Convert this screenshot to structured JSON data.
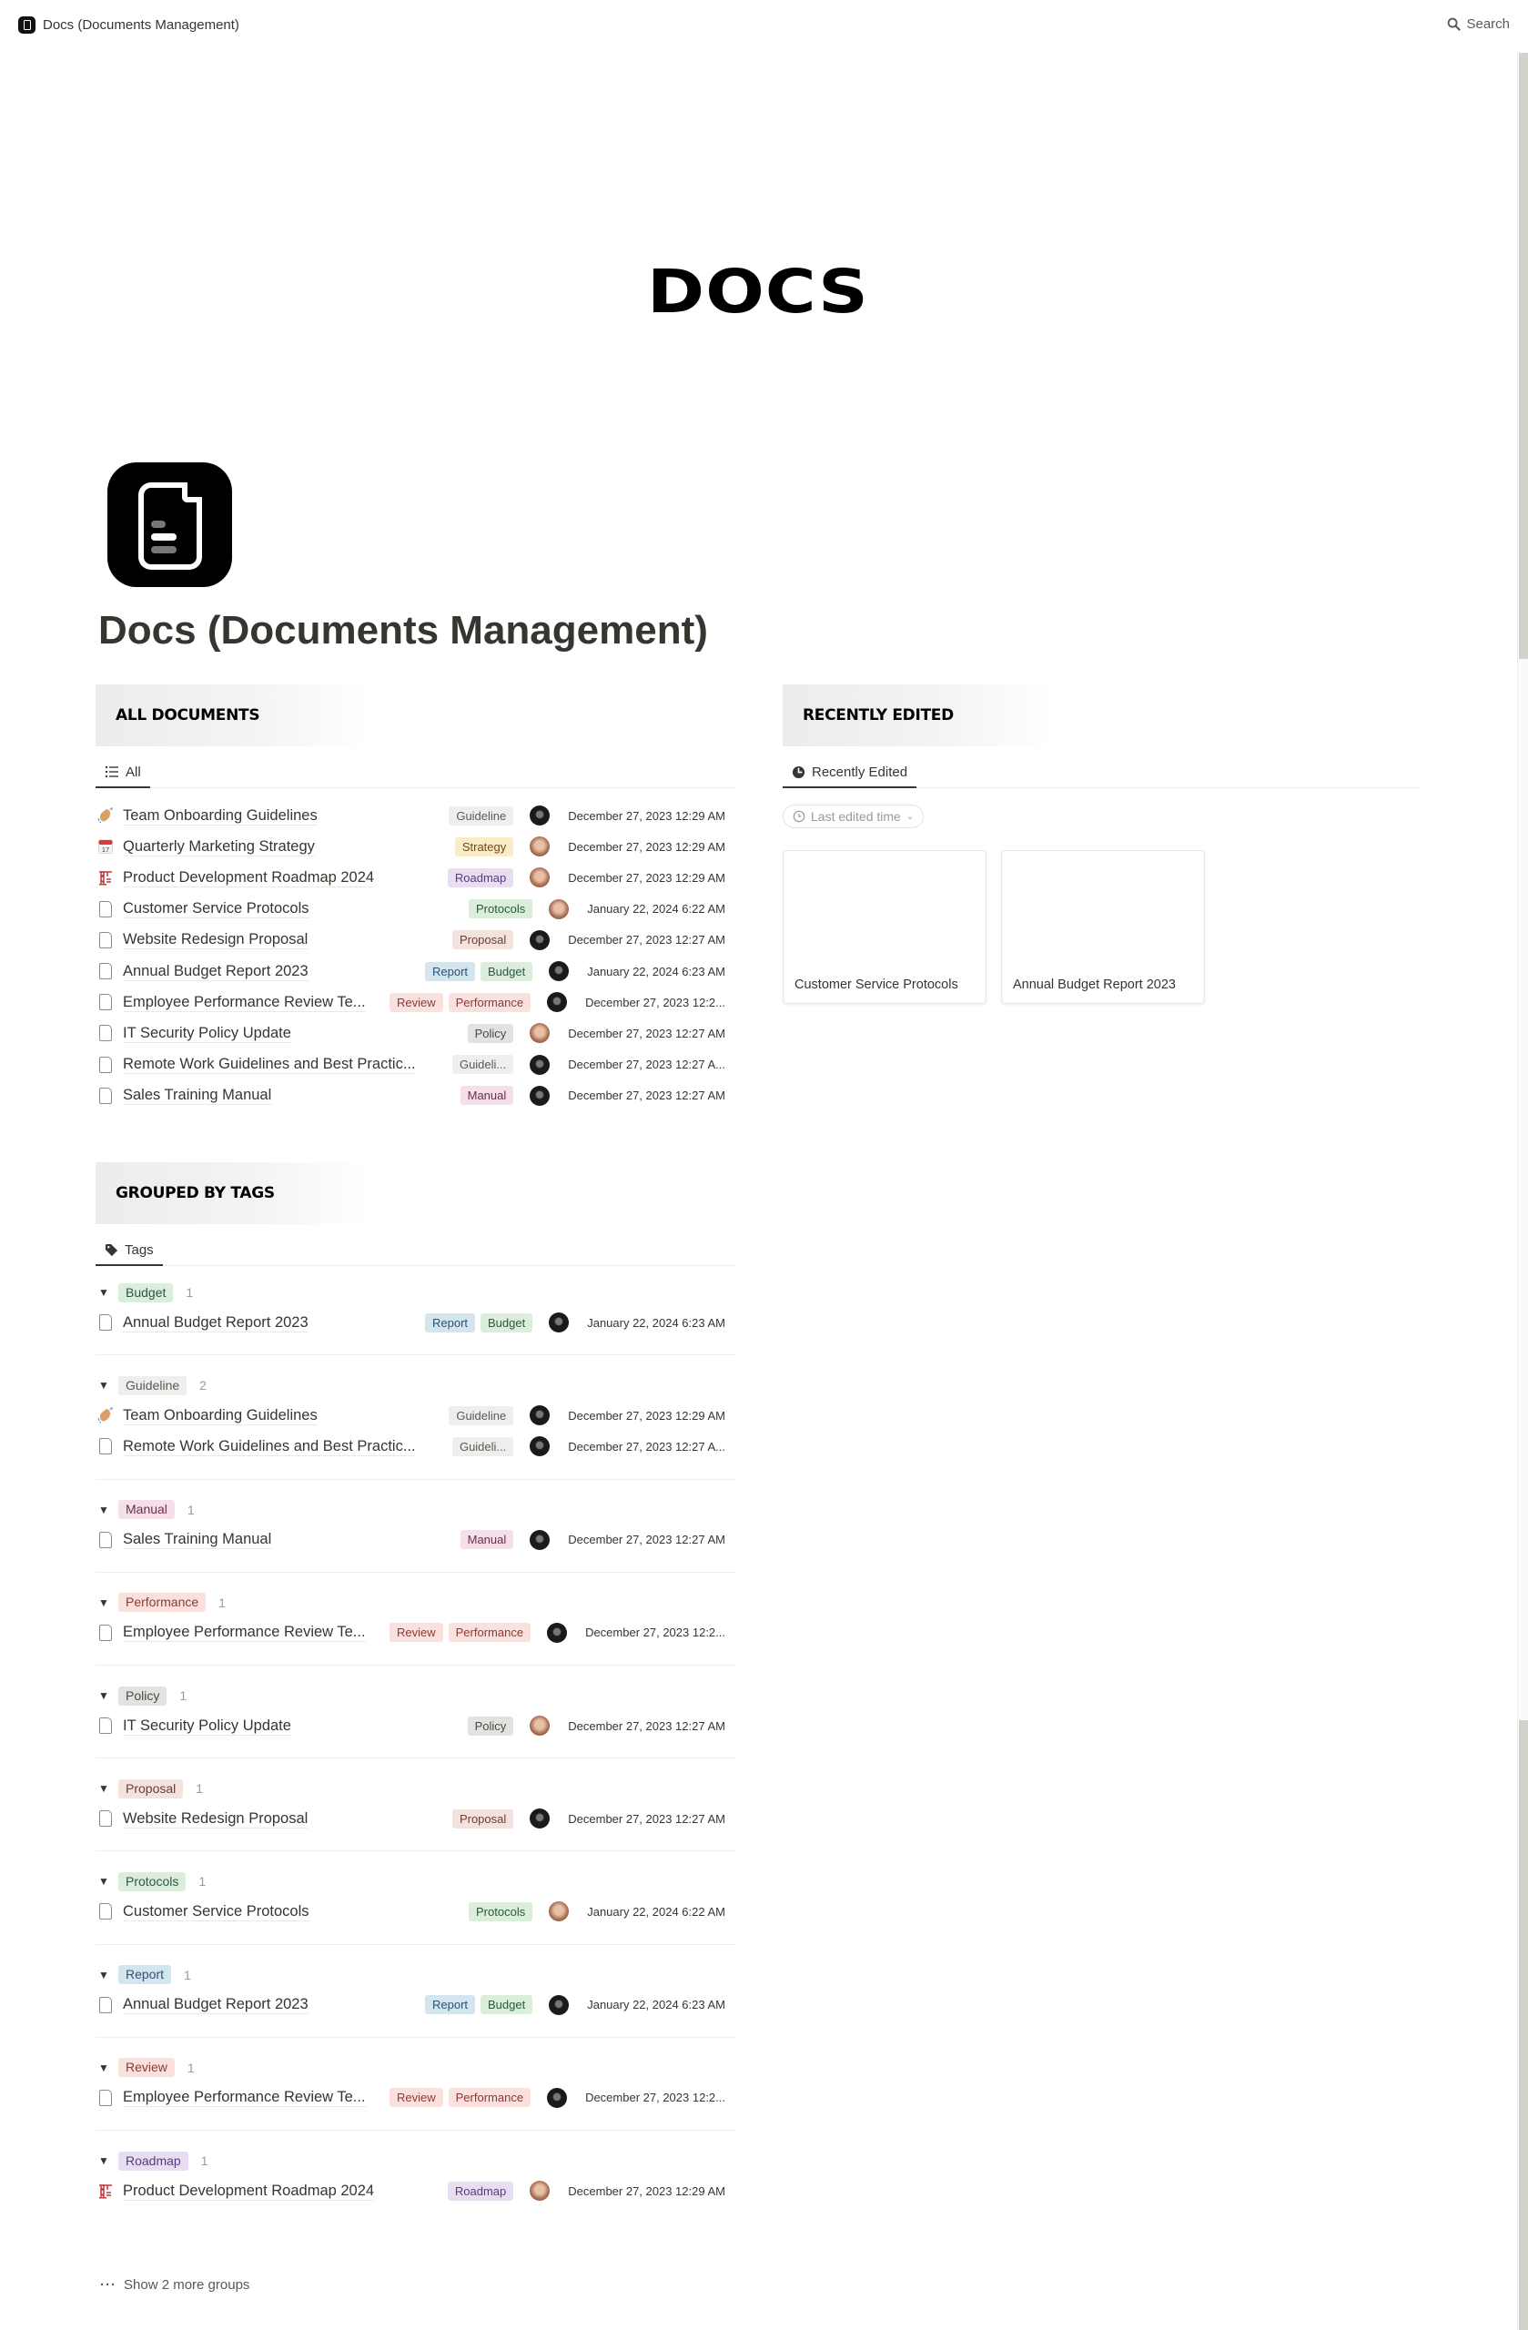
{
  "topbar": {
    "breadcrumb": "Docs (Documents Management)",
    "search_label": "Search"
  },
  "hero": {
    "wordmark": "DOCS"
  },
  "page": {
    "title": "Docs (Documents Management)"
  },
  "tag_colors": {
    "Guideline": {
      "bg": "#eeeeed",
      "fg": "#5a5955"
    },
    "Strategy": {
      "bg": "#fbecc8",
      "fg": "#6d4a1e"
    },
    "Roadmap": {
      "bg": "#e8def2",
      "fg": "#5a3b7a"
    },
    "Protocols": {
      "bg": "#dbeddb",
      "fg": "#2b593f"
    },
    "Proposal": {
      "bg": "#f3e2dd",
      "fg": "#6b3f32"
    },
    "Report": {
      "bg": "#d3e5ef",
      "fg": "#2d5277"
    },
    "Budget": {
      "bg": "#dbeddb",
      "fg": "#2b593f"
    },
    "Review": {
      "bg": "#fbe1de",
      "fg": "#8a3a33"
    },
    "Performance": {
      "bg": "#fbe1de",
      "fg": "#8a3a33"
    },
    "Policy": {
      "bg": "#e3e2e0",
      "fg": "#4a4945"
    },
    "Manual": {
      "bg": "#f5e0e9",
      "fg": "#6d2e4e"
    },
    "Guideli...": {
      "bg": "#eeeeed",
      "fg": "#5a5955"
    }
  },
  "all_documents": {
    "header": "ALL DOCUMENTS",
    "tab_label": "All",
    "rows": [
      {
        "icon": "waving-hand-icon",
        "name": "Team Onboarding Guidelines",
        "tags": [
          "Guideline"
        ],
        "avatar": "dark",
        "date": "December 27, 2023 12:29 AM"
      },
      {
        "icon": "calendar-icon",
        "name": "Quarterly Marketing Strategy",
        "tags": [
          "Strategy"
        ],
        "avatar": "light",
        "date": "December 27, 2023 12:29 AM"
      },
      {
        "icon": "crane-icon",
        "name": "Product Development Roadmap 2024",
        "tags": [
          "Roadmap"
        ],
        "avatar": "light",
        "date": "December 27, 2023 12:29 AM"
      },
      {
        "icon": "file-icon",
        "name": "Customer Service Protocols",
        "tags": [
          "Protocols"
        ],
        "avatar": "light",
        "date": "January 22, 2024 6:22 AM"
      },
      {
        "icon": "file-icon",
        "name": "Website Redesign Proposal",
        "tags": [
          "Proposal"
        ],
        "avatar": "dark",
        "date": "December 27, 2023 12:27 AM"
      },
      {
        "icon": "file-icon",
        "name": "Annual Budget Report 2023",
        "tags": [
          "Report",
          "Budget"
        ],
        "avatar": "dark",
        "date": "January 22, 2024 6:23 AM"
      },
      {
        "icon": "file-icon",
        "name": "Employee Performance Review Te...",
        "tags": [
          "Review",
          "Performance"
        ],
        "avatar": "dark",
        "date": "December 27, 2023 12:2..."
      },
      {
        "icon": "file-icon",
        "name": "IT Security Policy Update",
        "tags": [
          "Policy"
        ],
        "avatar": "light",
        "date": "December 27, 2023 12:27 AM"
      },
      {
        "icon": "file-icon",
        "name": "Remote Work Guidelines and Best Practic...",
        "tags": [
          "Guideli..."
        ],
        "avatar": "dark",
        "date": "December 27, 2023 12:27 A..."
      },
      {
        "icon": "file-icon",
        "name": "Sales Training Manual",
        "tags": [
          "Manual"
        ],
        "avatar": "dark",
        "date": "December 27, 2023 12:27 AM"
      }
    ]
  },
  "recently_edited": {
    "header": "RECENTLY EDITED",
    "tab_label": "Recently Edited",
    "filter_label": "Last edited time",
    "cards": [
      {
        "title": "Customer Service Protocols"
      },
      {
        "title": "Annual Budget Report 2023"
      }
    ]
  },
  "grouped_by_tags": {
    "header": "GROUPED BY TAGS",
    "tab_label": "Tags",
    "groups": [
      {
        "tag": "Budget",
        "count": "1",
        "rows": [
          {
            "icon": "file-icon",
            "name": "Annual Budget Report 2023",
            "tags": [
              "Report",
              "Budget"
            ],
            "avatar": "dark",
            "date": "January 22, 2024 6:23 AM"
          }
        ]
      },
      {
        "tag": "Guideline",
        "count": "2",
        "rows": [
          {
            "icon": "waving-hand-icon",
            "name": "Team Onboarding Guidelines",
            "tags": [
              "Guideline"
            ],
            "avatar": "dark",
            "date": "December 27, 2023 12:29 AM"
          },
          {
            "icon": "file-icon",
            "name": "Remote Work Guidelines and Best Practic...",
            "tags": [
              "Guideli..."
            ],
            "avatar": "dark",
            "date": "December 27, 2023 12:27 A..."
          }
        ]
      },
      {
        "tag": "Manual",
        "count": "1",
        "rows": [
          {
            "icon": "file-icon",
            "name": "Sales Training Manual",
            "tags": [
              "Manual"
            ],
            "avatar": "dark",
            "date": "December 27, 2023 12:27 AM"
          }
        ]
      },
      {
        "tag": "Performance",
        "count": "1",
        "rows": [
          {
            "icon": "file-icon",
            "name": "Employee Performance Review Te...",
            "tags": [
              "Review",
              "Performance"
            ],
            "avatar": "dark",
            "date": "December 27, 2023 12:2..."
          }
        ]
      },
      {
        "tag": "Policy",
        "count": "1",
        "rows": [
          {
            "icon": "file-icon",
            "name": "IT Security Policy Update",
            "tags": [
              "Policy"
            ],
            "avatar": "light",
            "date": "December 27, 2023 12:27 AM"
          }
        ]
      },
      {
        "tag": "Proposal",
        "count": "1",
        "rows": [
          {
            "icon": "file-icon",
            "name": "Website Redesign Proposal",
            "tags": [
              "Proposal"
            ],
            "avatar": "dark",
            "date": "December 27, 2023 12:27 AM"
          }
        ]
      },
      {
        "tag": "Protocols",
        "count": "1",
        "rows": [
          {
            "icon": "file-icon",
            "name": "Customer Service Protocols",
            "tags": [
              "Protocols"
            ],
            "avatar": "light",
            "date": "January 22, 2024 6:22 AM"
          }
        ]
      },
      {
        "tag": "Report",
        "count": "1",
        "rows": [
          {
            "icon": "file-icon",
            "name": "Annual Budget Report 2023",
            "tags": [
              "Report",
              "Budget"
            ],
            "avatar": "dark",
            "date": "January 22, 2024 6:23 AM"
          }
        ]
      },
      {
        "tag": "Review",
        "count": "1",
        "rows": [
          {
            "icon": "file-icon",
            "name": "Employee Performance Review Te...",
            "tags": [
              "Review",
              "Performance"
            ],
            "avatar": "dark",
            "date": "December 27, 2023 12:2..."
          }
        ]
      },
      {
        "tag": "Roadmap",
        "count": "1",
        "rows": [
          {
            "icon": "crane-icon",
            "name": "Product Development Roadmap 2024",
            "tags": [
              "Roadmap"
            ],
            "avatar": "light",
            "date": "December 27, 2023 12:29 AM"
          }
        ]
      }
    ],
    "show_more_label": "Show 2 more groups"
  }
}
